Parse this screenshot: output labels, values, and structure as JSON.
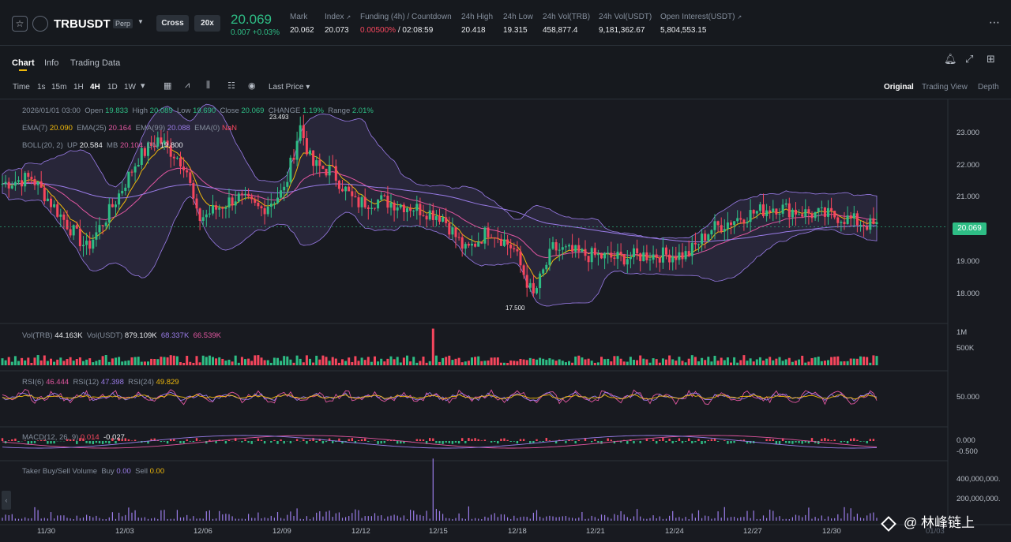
{
  "header": {
    "symbol": "TRBUSDT",
    "contract_type": "Perp",
    "margin_mode": "Cross",
    "leverage": "20x",
    "last_price": "20.069",
    "change": "0.007 +0.03%",
    "stats": [
      {
        "label": "Mark",
        "value": "20.062"
      },
      {
        "label": "Index",
        "value": "20.073"
      },
      {
        "label": "Funding (4h) / Countdown",
        "value": "0.00500%",
        "value2": " / 02:08:59"
      },
      {
        "label": "24h High",
        "value": "20.418"
      },
      {
        "label": "24h Low",
        "value": "19.315"
      },
      {
        "label": "24h Vol(TRB)",
        "value": "458,877.4"
      },
      {
        "label": "24h Vol(USDT)",
        "value": "9,181,362.67"
      },
      {
        "label": "Open Interest(USDT)",
        "value": "5,804,553.15"
      }
    ]
  },
  "tabs": [
    "Chart",
    "Info",
    "Trading Data"
  ],
  "toolbar": {
    "intervals": [
      "Time",
      "1s",
      "15m",
      "1H",
      "4H",
      "1D",
      "1W"
    ],
    "price_type": "Last Price",
    "views": [
      "Original",
      "Trading View",
      "Depth"
    ]
  },
  "legend": {
    "ohlc": {
      "date": "2026/01/01 03:00",
      "open_label": "Open",
      "open": "19.833",
      "high_label": "High",
      "high": "20.089",
      "low_label": "Low",
      "low": "19.690",
      "close_label": "Close",
      "close": "20.069",
      "change_label": "CHANGE",
      "change": "1.19%",
      "range_label": "Range",
      "range": "2.01%"
    },
    "ema": {
      "ema7_label": "EMA(7)",
      "ema7": "20.090",
      "ema25_label": "EMA(25)",
      "ema25": "20.164",
      "ema99_label": "EMA(99)",
      "ema99": "20.088",
      "ema0_label": "EMA(0)",
      "ema0": "NaN"
    },
    "boll": {
      "label": "BOLL(20, 2)",
      "up_label": "UP",
      "up": "20.584",
      "mb_label": "MB",
      "mb": "20.104",
      "dn_label": "DN",
      "dn": "19.800"
    },
    "vol": {
      "label": "Vol(TRB)",
      "value": "44.163K",
      "usdt_label": "Vol(USDT)",
      "usdt": "879.109K",
      "ma1": "68.337K",
      "ma2": "66.539K"
    },
    "rsi": {
      "rsi6_label": "RSI(6)",
      "rsi6": "46.444",
      "rsi12_label": "RSI(12)",
      "rsi12": "47.398",
      "rsi24_label": "RSI(24)",
      "rsi24": "49.829"
    },
    "macd": {
      "label": "MACD(12, 26, 9)",
      "v1": "0.014",
      "v2": "-0.027"
    },
    "taker": {
      "label": "Taker Buy/Sell Volume",
      "buy_label": "Buy",
      "buy": "0.00",
      "sell_label": "Sell",
      "sell": "0.00"
    }
  },
  "price_axis": [
    "23.000",
    "22.000",
    "21.000",
    "20.000",
    "19.000",
    "18.000"
  ],
  "current_price_tag": "20.069",
  "high_marker": "23.493",
  "low_marker": "17.500",
  "vol_axis": [
    "1M",
    "500K"
  ],
  "rsi_axis": [
    "50.000"
  ],
  "macd_axis": [
    "0.000",
    "-0.500"
  ],
  "taker_axis": [
    "400,000,000.",
    "200,000,000."
  ],
  "time_axis": [
    "11/30",
    "12/03",
    "12/06",
    "12/09",
    "12/12",
    "12/15",
    "12/18",
    "12/21",
    "12/24",
    "12/27",
    "12/30",
    "01/03"
  ],
  "watermark": "@ 林峰链上",
  "colors": {
    "up": "#2ebd85",
    "down": "#f6465d",
    "ema7": "#f0b90b",
    "ema25": "#e056a0",
    "ema99": "#9a7ce8",
    "boll": "#9a7ce8",
    "bg": "#181a20"
  },
  "icons": [
    "star-icon",
    "bell-icon",
    "expand-icon",
    "grid-icon"
  ]
}
